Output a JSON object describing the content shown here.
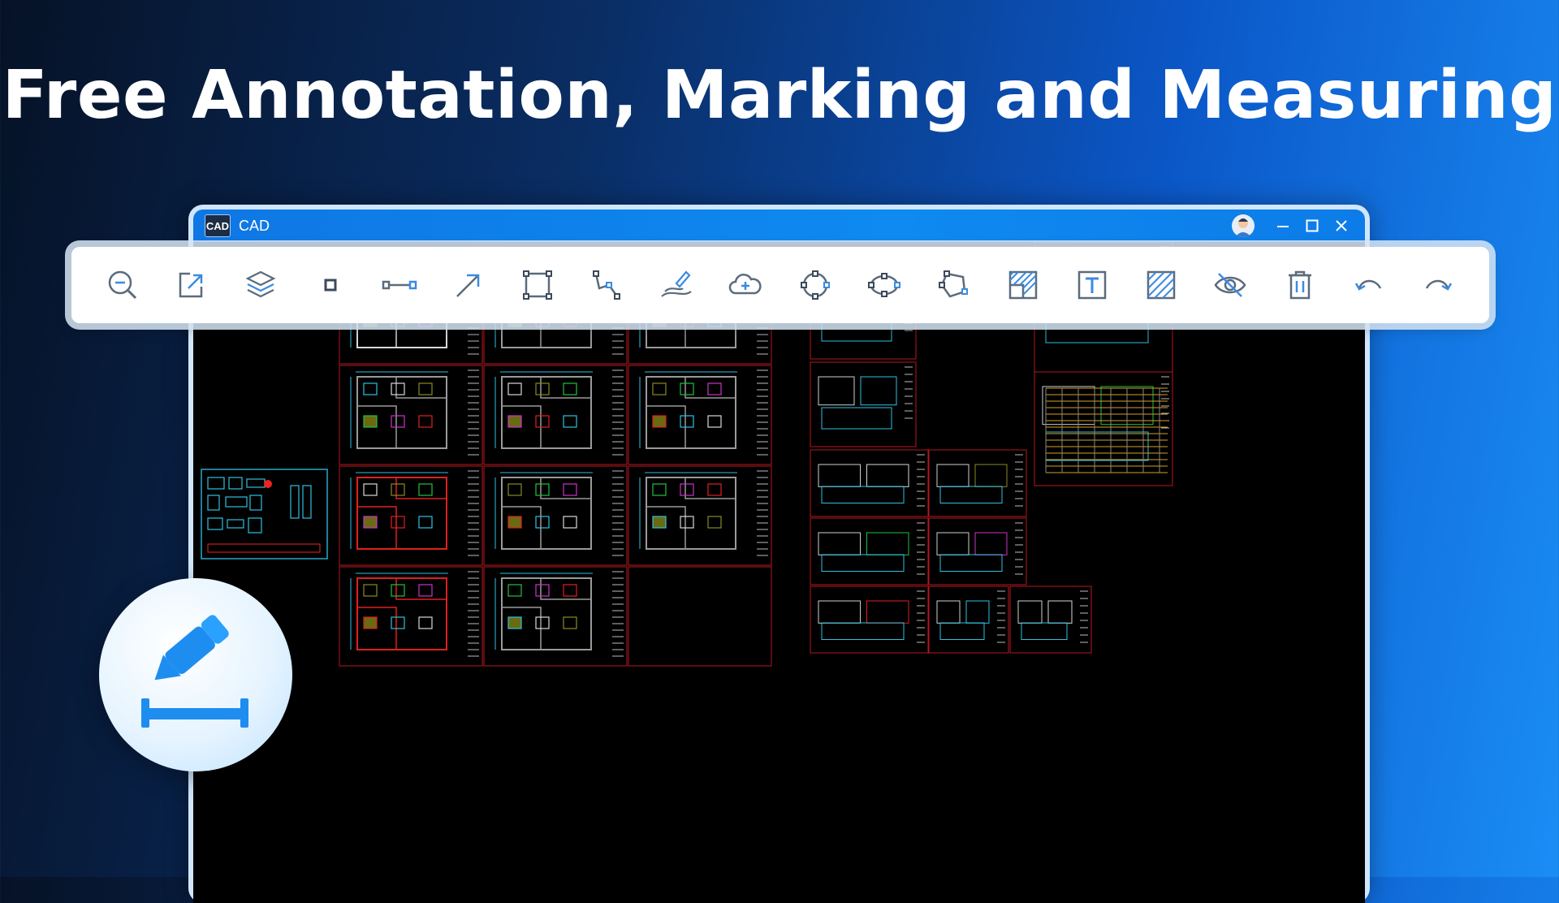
{
  "headline": "Free Annotation, Marking and Measuring",
  "window": {
    "app_logo_text": "CAD",
    "title": "CAD"
  },
  "toolbar": {
    "tools": [
      {
        "name": "zoom-out-icon"
      },
      {
        "name": "export-icon"
      },
      {
        "name": "layers-icon"
      },
      {
        "name": "rectangle-small-icon"
      },
      {
        "name": "measure-distance-icon"
      },
      {
        "name": "arrow-icon"
      },
      {
        "name": "rectangle-select-icon"
      },
      {
        "name": "polyline-icon"
      },
      {
        "name": "freehand-pen-icon"
      },
      {
        "name": "cloud-markup-icon"
      },
      {
        "name": "circle-markup-icon"
      },
      {
        "name": "ellipse-markup-icon"
      },
      {
        "name": "polygon-markup-icon"
      },
      {
        "name": "area-hatch-icon"
      },
      {
        "name": "text-tool-icon"
      },
      {
        "name": "hatch-icon"
      },
      {
        "name": "hide-markups-icon"
      },
      {
        "name": "delete-icon"
      },
      {
        "name": "undo-icon"
      },
      {
        "name": "redo-icon"
      }
    ]
  },
  "colors": {
    "accent": "#1a8df5",
    "toolbar_icon": "#5b6b7c",
    "toolbar_icon_blue": "#3b8be0",
    "drawing_border": "#b3171f",
    "canvas": "#000000"
  }
}
